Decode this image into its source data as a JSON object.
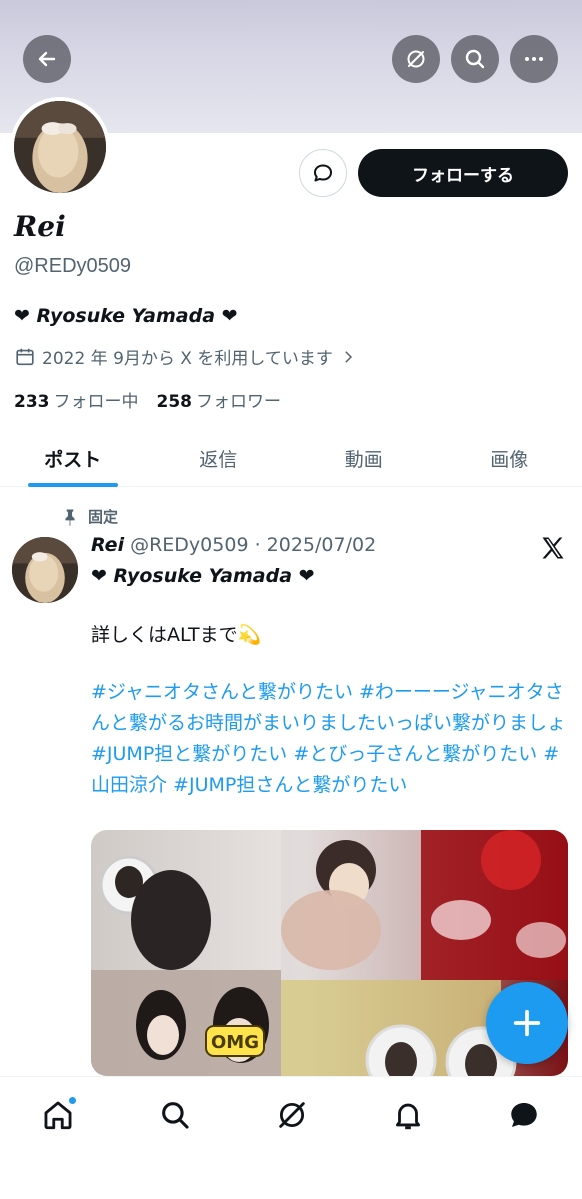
{
  "header": {
    "back_icon": "arrow-left-icon",
    "grok_icon": "grok-icon",
    "search_icon": "search-icon",
    "more_icon": "more-icon"
  },
  "profile": {
    "display_name": "Rei",
    "handle": "@REDy0509",
    "bio": "❤ Ryosuke Yamada ❤",
    "joined": "2022 年 9月から X を利用しています",
    "following_count": "233",
    "following_label": "フォロー中",
    "followers_count": "258",
    "followers_label": "フォロワー",
    "follow_button_label": "フォローする"
  },
  "tabs": [
    {
      "label": "ポスト",
      "active": true
    },
    {
      "label": "返信",
      "active": false
    },
    {
      "label": "動画",
      "active": false
    },
    {
      "label": "画像",
      "active": false
    }
  ],
  "post": {
    "pinned_label": "固定",
    "name": "Rei",
    "handle_date": "@REDy0509 · 2025/07/02",
    "author_bio": "❤ Ryosuke Yamada ❤",
    "text": "詳しくはALTまで💫",
    "hashtags": "#ジャニオタさんと繋がりたい #わーーージャニオタさんと繋がるお時間がまいりましたいっぱい繋がりましょ #JUMP担と繋がりたい #とびっ子さんと繋がりたい #山田涼介 #JUMP担さんと繋がりたい",
    "media_stamp": "OMG"
  },
  "colors": {
    "accent": "#1d9bf0",
    "text": "#0f1419",
    "muted": "#536471"
  },
  "bottom_nav": [
    "home-icon",
    "search-icon",
    "grok-icon",
    "notifications-icon",
    "messages-icon"
  ]
}
